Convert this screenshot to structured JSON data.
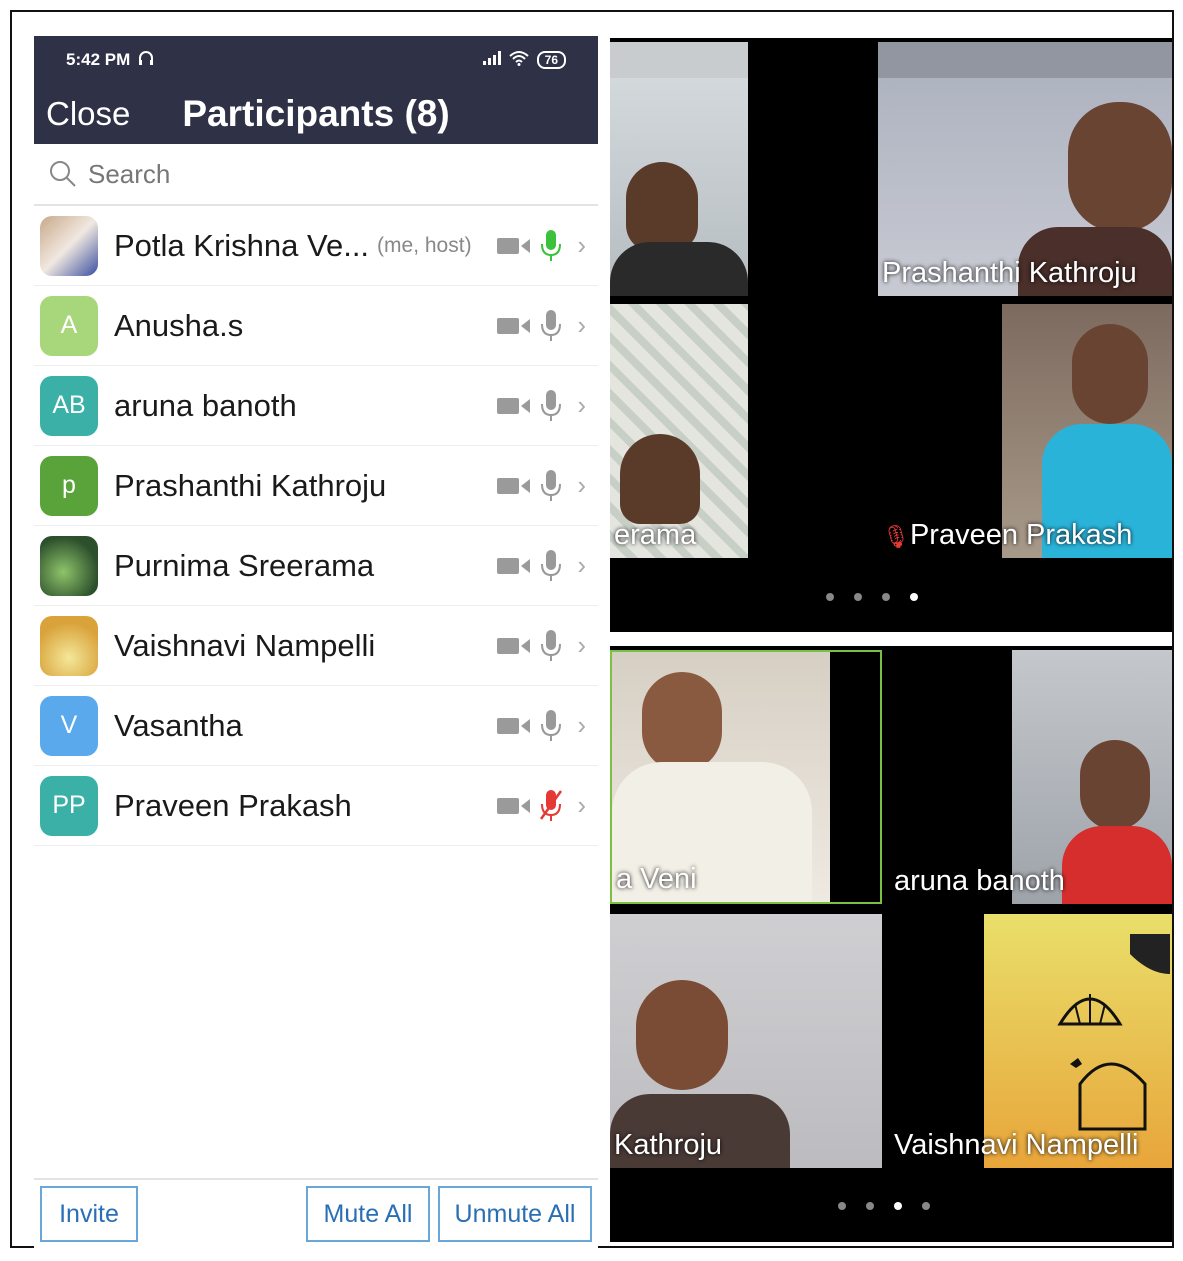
{
  "status_bar": {
    "time": "5:42 PM",
    "headset_icon": "headset-icon",
    "battery": "76"
  },
  "header": {
    "close_label": "Close",
    "title": "Participants (8)"
  },
  "search": {
    "placeholder": "Search"
  },
  "participants": [
    {
      "name": "Potla Krishna Ve...",
      "tag": "(me, host)",
      "avatar_type": "photo",
      "mic": "active"
    },
    {
      "name": "Anusha.s",
      "initials": "A",
      "avatar_color": "#a8d67a",
      "mic": "on"
    },
    {
      "name": "aruna banoth",
      "initials": "AB",
      "avatar_color": "#3ab0a6",
      "mic": "on"
    },
    {
      "name": "Prashanthi Kathroju",
      "initials": "p",
      "avatar_color": "#5aa33a",
      "mic": "on"
    },
    {
      "name": "Purnima Sreerama",
      "avatar_type": "photo",
      "mic": "on"
    },
    {
      "name": "Vaishnavi Nampelli",
      "avatar_type": "photo",
      "mic": "on"
    },
    {
      "name": "Vasantha",
      "initials": "V",
      "avatar_color": "#5aa9ec",
      "mic": "on"
    },
    {
      "name": "Praveen Prakash",
      "initials": "PP",
      "avatar_color": "#3ab0a6",
      "mic": "muted"
    }
  ],
  "footer": {
    "invite_label": "Invite",
    "mute_all_label": "Mute All",
    "unmute_all_label": "Unmute All"
  },
  "video_page_1": {
    "tiles": [
      "",
      "Prashanthi Kathroju",
      "erama",
      "Praveen Prakash"
    ],
    "page_indicator": {
      "count": 4,
      "active": 4
    }
  },
  "video_page_2": {
    "tiles": [
      "a Veni",
      "aruna banoth",
      "Kathroju",
      "Vaishnavi Nampelli"
    ],
    "page_indicator": {
      "count": 4,
      "active": 3
    }
  },
  "colors": {
    "header_bg": "#2f3147",
    "accent_blue": "#2a6fb5",
    "mic_active": "#3cc13c",
    "mic_muted": "#e53935"
  }
}
